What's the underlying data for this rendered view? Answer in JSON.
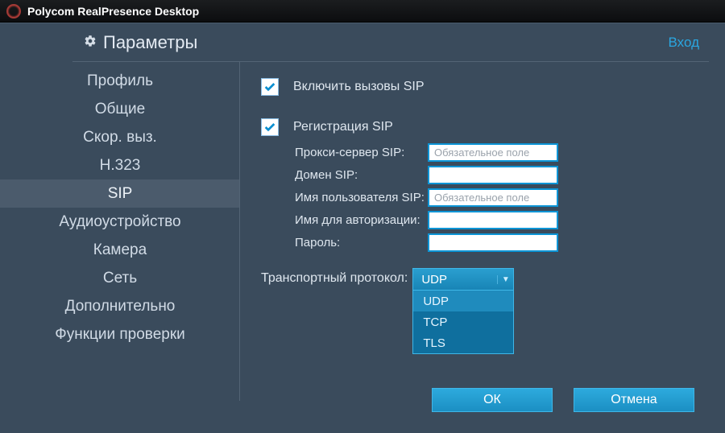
{
  "app": {
    "title": "Polycom RealPresence Desktop"
  },
  "header": {
    "title": "Параметры",
    "login": "Вход"
  },
  "sidebar": {
    "items": [
      {
        "label": "Профиль"
      },
      {
        "label": "Общие"
      },
      {
        "label": "Скор. выз."
      },
      {
        "label": "H.323"
      },
      {
        "label": "SIP"
      },
      {
        "label": "Аудиоустройство"
      },
      {
        "label": "Камера"
      },
      {
        "label": "Сеть"
      },
      {
        "label": "Дополнительно"
      },
      {
        "label": "Функции проверки"
      }
    ],
    "activeIndex": 4
  },
  "form": {
    "enable_sip": {
      "label": "Включить вызовы SIP",
      "checked": true
    },
    "register_sip": {
      "label": "Регистрация SIP",
      "checked": true
    },
    "fields": {
      "proxy": {
        "label": "Прокси-сервер SIP:",
        "value": "",
        "placeholder": "Обязательное поле"
      },
      "domain": {
        "label": "Домен SIP:",
        "value": "",
        "placeholder": ""
      },
      "user": {
        "label": "Имя пользователя SIP:",
        "value": "",
        "placeholder": "Обязательное поле"
      },
      "authname": {
        "label": "Имя для авторизации:",
        "value": "",
        "placeholder": ""
      },
      "password": {
        "label": "Пароль:",
        "value": "",
        "placeholder": ""
      }
    },
    "transport": {
      "label": "Транспортный протокол:",
      "selected": "UDP",
      "options": [
        "UDP",
        "TCP",
        "TLS"
      ],
      "open": true
    }
  },
  "buttons": {
    "ok": "ОК",
    "cancel": "Отмена"
  }
}
